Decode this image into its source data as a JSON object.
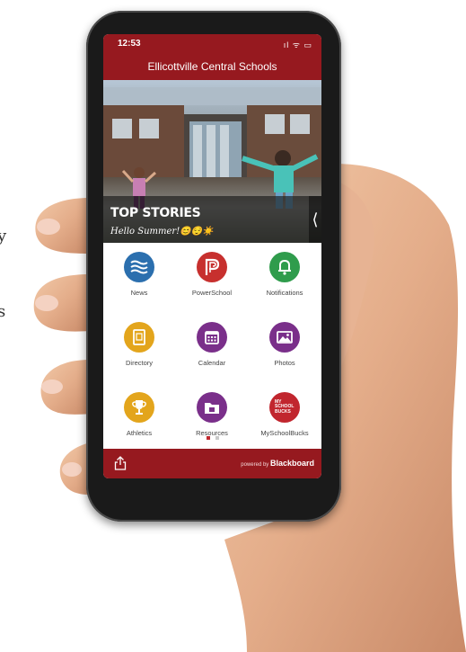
{
  "background_text": {
    "line1": "y",
    "line2": "s"
  },
  "status": {
    "time": "12:53",
    "icons": "ıl ᯤ ▭"
  },
  "app": {
    "title": "Ellicottville Central Schools"
  },
  "hero": {
    "heading": "TOP STORIES",
    "caption": "Hello Summer!😊😌☀️",
    "arrow": "⟨"
  },
  "tiles": [
    {
      "label": "News",
      "color": "#2b6fae",
      "icon": "waves-icon"
    },
    {
      "label": "PowerSchool",
      "color": "#c7302e",
      "icon": "powerschool-icon"
    },
    {
      "label": "Notifications",
      "color": "#2f9c4c",
      "icon": "bell-icon"
    },
    {
      "label": "Directory",
      "color": "#e3a51c",
      "icon": "directory-book-icon"
    },
    {
      "label": "Calendar",
      "color": "#7a2f8a",
      "icon": "calendar-icon"
    },
    {
      "label": "Photos",
      "color": "#7a2f8a",
      "icon": "photos-icon"
    },
    {
      "label": "Athletics",
      "color": "#e3a51c",
      "icon": "trophy-icon"
    },
    {
      "label": "Resources",
      "color": "#7a2f8a",
      "icon": "folder-icon"
    },
    {
      "label": "MySchoolBucks",
      "color": "#c1262e",
      "icon": "myschoolbucks-logo"
    }
  ],
  "myschoolbucks_logo": "MY SCHOOL BUCKS",
  "pager": {
    "page": 1,
    "pages": 2
  },
  "footer": {
    "powered_by": "powered by ",
    "brand": "Blackboard"
  },
  "colors": {
    "brand": "#96191f"
  }
}
